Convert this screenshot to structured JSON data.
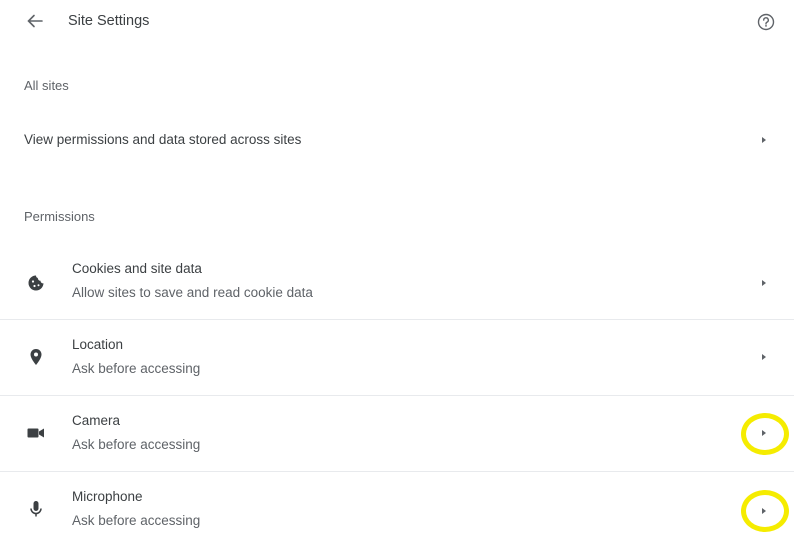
{
  "header": {
    "title": "Site Settings",
    "back_icon": "arrow-left-icon",
    "help_icon": "help-circle-icon"
  },
  "all_sites": {
    "section_label": "All sites",
    "row_label": "View permissions and data stored across sites"
  },
  "permissions": {
    "section_label": "Permissions",
    "items": [
      {
        "title": "Cookies and site data",
        "subtitle": "Allow sites to save and read cookie data",
        "icon": "cookie-icon",
        "highlighted": false
      },
      {
        "title": "Location",
        "subtitle": "Ask before accessing",
        "icon": "location-pin-icon",
        "highlighted": false
      },
      {
        "title": "Camera",
        "subtitle": "Ask before accessing",
        "icon": "camera-icon",
        "highlighted": true
      },
      {
        "title": "Microphone",
        "subtitle": "Ask before accessing",
        "icon": "microphone-icon",
        "highlighted": true
      }
    ]
  },
  "colors": {
    "highlight": "#f5ec00",
    "text_primary": "#3c4043",
    "text_secondary": "#5f6368",
    "divider": "#e8eaed"
  }
}
